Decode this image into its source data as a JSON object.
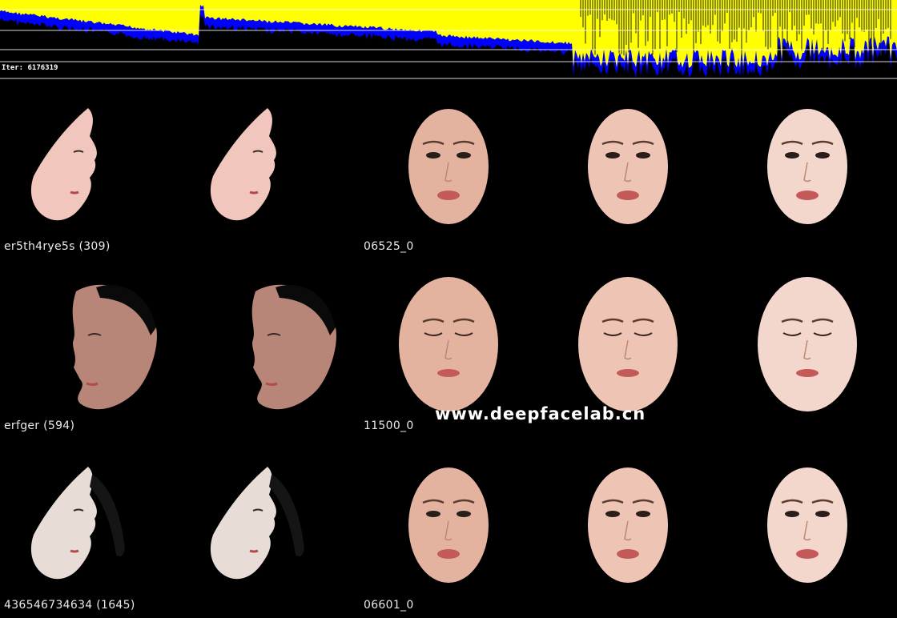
{
  "graph": {
    "iter_text": "Iter: 6176319",
    "colors": {
      "src_loss": "#ffff00",
      "dst_loss": "#0000ff",
      "gridline": "#ffffff"
    }
  },
  "rows": [
    {
      "label": "er5th4rye5s (309)",
      "sample_id": "06525_0",
      "face_pose": "profile",
      "expression": "open-mouth"
    },
    {
      "label": "erfger (594)",
      "sample_id": "11500_0",
      "face_pose": "three-quarter",
      "expression": "eyes-closed"
    },
    {
      "label": "436546734634 (1645)",
      "sample_id": "06601_0",
      "face_pose": "profile",
      "expression": "open-mouth"
    }
  ],
  "watermark": "www.deepfacelab.cn"
}
